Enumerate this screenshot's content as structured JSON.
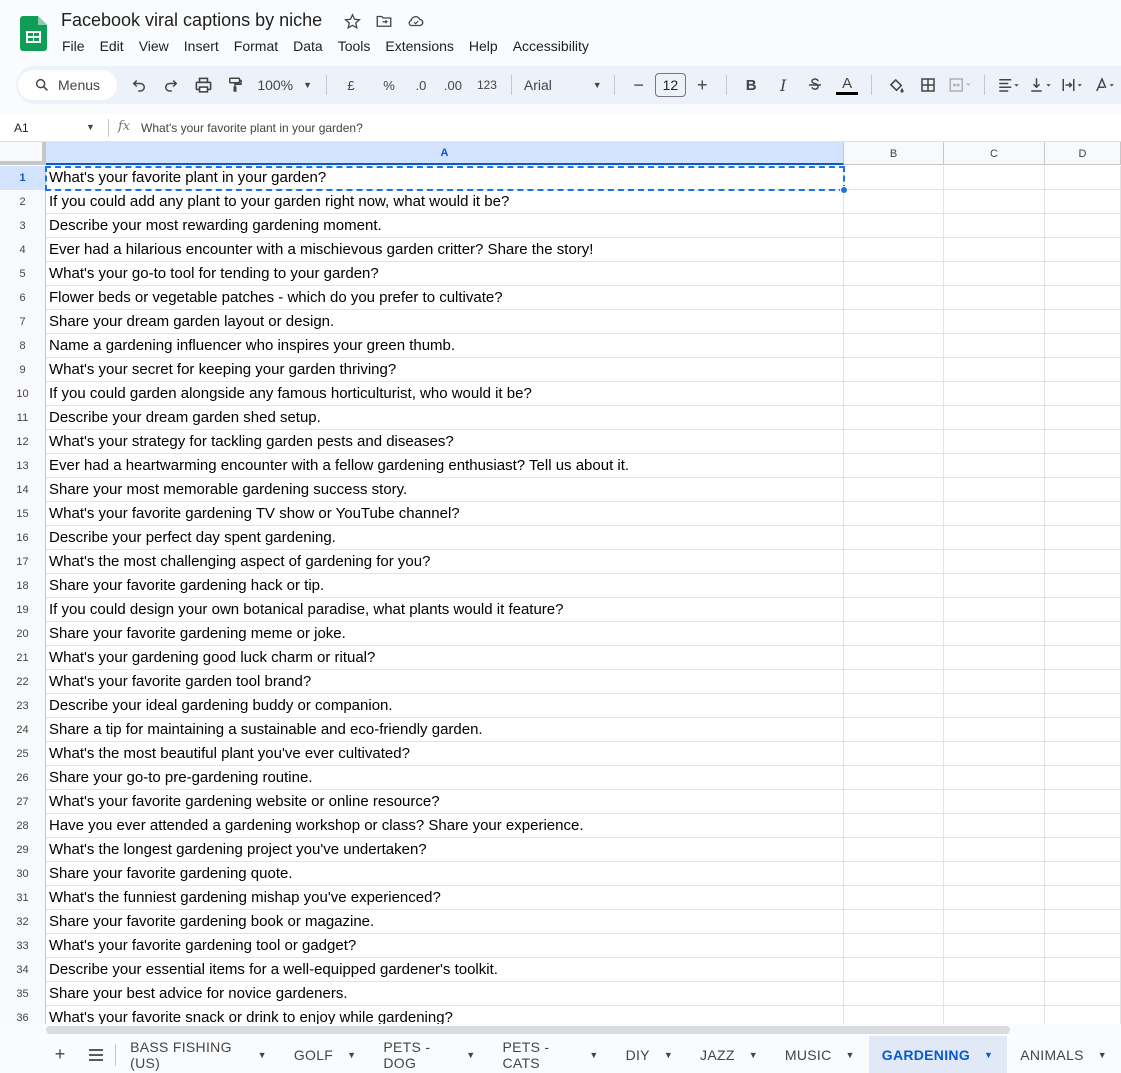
{
  "doc": {
    "title": "Facebook viral captions by niche",
    "menus": [
      "File",
      "Edit",
      "View",
      "Insert",
      "Format",
      "Data",
      "Tools",
      "Extensions",
      "Help",
      "Accessibility"
    ]
  },
  "toolbar": {
    "search_label": "Menus",
    "zoom": "100%",
    "currency": "£",
    "percent": "%",
    "decrease_decimal": ".0",
    "increase_decimal": ".00",
    "number_format": "123",
    "font": "Arial",
    "font_size": "12",
    "minus": "−",
    "plus": "+",
    "bold": "B",
    "italic": "I",
    "text_color": "A",
    "text_color_bar": "#000000"
  },
  "formula_bar": {
    "cell_ref": "A1",
    "fx": "fx",
    "content": "What's your favorite plant in your garden?"
  },
  "columns": [
    "A",
    "B",
    "C",
    "D"
  ],
  "rows": [
    {
      "n": "1",
      "a": "What's your favorite plant in your garden?"
    },
    {
      "n": "2",
      "a": "If you could add any plant to your garden right now, what would it be?"
    },
    {
      "n": "3",
      "a": "Describe your most rewarding gardening moment."
    },
    {
      "n": "4",
      "a": "Ever had a hilarious encounter with a mischievous garden critter? Share the story!"
    },
    {
      "n": "5",
      "a": "What's your go-to tool for tending to your garden?"
    },
    {
      "n": "6",
      "a": "Flower beds or vegetable patches - which do you prefer to cultivate?"
    },
    {
      "n": "7",
      "a": "Share your dream garden layout or design."
    },
    {
      "n": "8",
      "a": "Name a gardening influencer who inspires your green thumb."
    },
    {
      "n": "9",
      "a": "What's your secret for keeping your garden thriving?"
    },
    {
      "n": "10",
      "a": "If you could garden alongside any famous horticulturist, who would it be?"
    },
    {
      "n": "11",
      "a": "Describe your dream garden shed setup."
    },
    {
      "n": "12",
      "a": "What's your strategy for tackling garden pests and diseases?"
    },
    {
      "n": "13",
      "a": "Ever had a heartwarming encounter with a fellow gardening enthusiast? Tell us about it."
    },
    {
      "n": "14",
      "a": "Share your most memorable gardening success story."
    },
    {
      "n": "15",
      "a": "What's your favorite gardening TV show or YouTube channel?"
    },
    {
      "n": "16",
      "a": "Describe your perfect day spent gardening."
    },
    {
      "n": "17",
      "a": "What's the most challenging aspect of gardening for you?"
    },
    {
      "n": "18",
      "a": "Share your favorite gardening hack or tip."
    },
    {
      "n": "19",
      "a": "If you could design your own botanical paradise, what plants would it feature?"
    },
    {
      "n": "20",
      "a": "Share your favorite gardening meme or joke."
    },
    {
      "n": "21",
      "a": "What's your gardening good luck charm or ritual?"
    },
    {
      "n": "22",
      "a": "What's your favorite garden tool brand?"
    },
    {
      "n": "23",
      "a": "Describe your ideal gardening buddy or companion."
    },
    {
      "n": "24",
      "a": "Share a tip for maintaining a sustainable and eco-friendly garden."
    },
    {
      "n": "25",
      "a": "What's the most beautiful plant you've ever cultivated?"
    },
    {
      "n": "26",
      "a": "Share your go-to pre-gardening routine."
    },
    {
      "n": "27",
      "a": "What's your favorite gardening website or online resource?"
    },
    {
      "n": "28",
      "a": "Have you ever attended a gardening workshop or class? Share your experience."
    },
    {
      "n": "29",
      "a": "What's the longest gardening project you've undertaken?"
    },
    {
      "n": "30",
      "a": "Share your favorite gardening quote."
    },
    {
      "n": "31",
      "a": "What's the funniest gardening mishap you've experienced?"
    },
    {
      "n": "32",
      "a": "Share your favorite gardening book or magazine."
    },
    {
      "n": "33",
      "a": "What's your favorite gardening tool or gadget?"
    },
    {
      "n": "34",
      "a": "Describe your essential items for a well-equipped gardener's toolkit."
    },
    {
      "n": "35",
      "a": "Share your best advice for novice gardeners."
    },
    {
      "n": "36",
      "a": "What's your favorite snack or drink to enjoy while gardening?"
    }
  ],
  "sheet_tabs": [
    {
      "label": "BASS FISHING (US)",
      "active": false
    },
    {
      "label": "GOLF",
      "active": false
    },
    {
      "label": "PETS - DOG",
      "active": false
    },
    {
      "label": "PETS - CATS",
      "active": false
    },
    {
      "label": "DIY",
      "active": false
    },
    {
      "label": "JAZZ",
      "active": false
    },
    {
      "label": "MUSIC",
      "active": false
    },
    {
      "label": "GARDENING",
      "active": true
    },
    {
      "label": "ANIMALS",
      "active": false
    }
  ],
  "colors": {
    "accent": "#0b57d0",
    "sheets_green": "#0f9d58"
  }
}
